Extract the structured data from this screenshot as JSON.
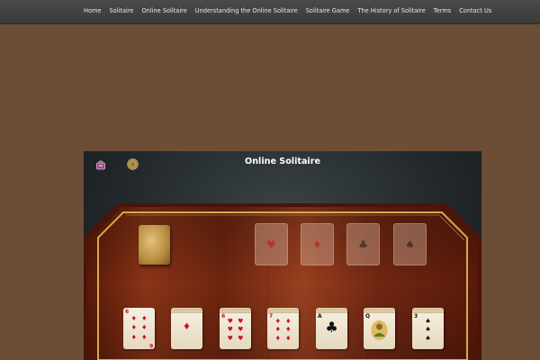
{
  "nav": {
    "items": [
      "Home",
      "Solitaire",
      "Online Solitaire",
      "Understanding the Online Solitaire",
      "Solitaire Game",
      "The History of Solitaire",
      "Terms",
      "Contact Us"
    ]
  },
  "game": {
    "title": "Online Solitaire",
    "icons": [
      "shop-basket-icon",
      "coin-icon"
    ],
    "foundations": [
      {
        "suit": "♥",
        "color": "red"
      },
      {
        "suit": "♦",
        "color": "red"
      },
      {
        "suit": "♣",
        "color": "black"
      },
      {
        "suit": "♠",
        "color": "black"
      }
    ],
    "tableau": [
      {
        "rank": "6",
        "suit": "♦",
        "color": "red",
        "stacked": false
      },
      {
        "rank": "",
        "suit": "",
        "color": "red",
        "stacked": true
      },
      {
        "rank": "6",
        "suit": "♥",
        "color": "red",
        "stacked": true
      },
      {
        "rank": "7",
        "suit": "♦",
        "color": "red",
        "stacked": true
      },
      {
        "rank": "A",
        "suit": "♣",
        "color": "black",
        "stacked": true
      },
      {
        "rank": "Q",
        "suit": "",
        "color": "black",
        "stacked": true
      },
      {
        "rank": "3",
        "suit": "♠",
        "color": "black",
        "stacked": true
      }
    ]
  },
  "colors": {
    "page_bg": "#6b4e35",
    "nav_bg": "#444444",
    "felt": "#23292c",
    "wood": "#7a2a12",
    "gold_rail": "#d9a84a"
  }
}
